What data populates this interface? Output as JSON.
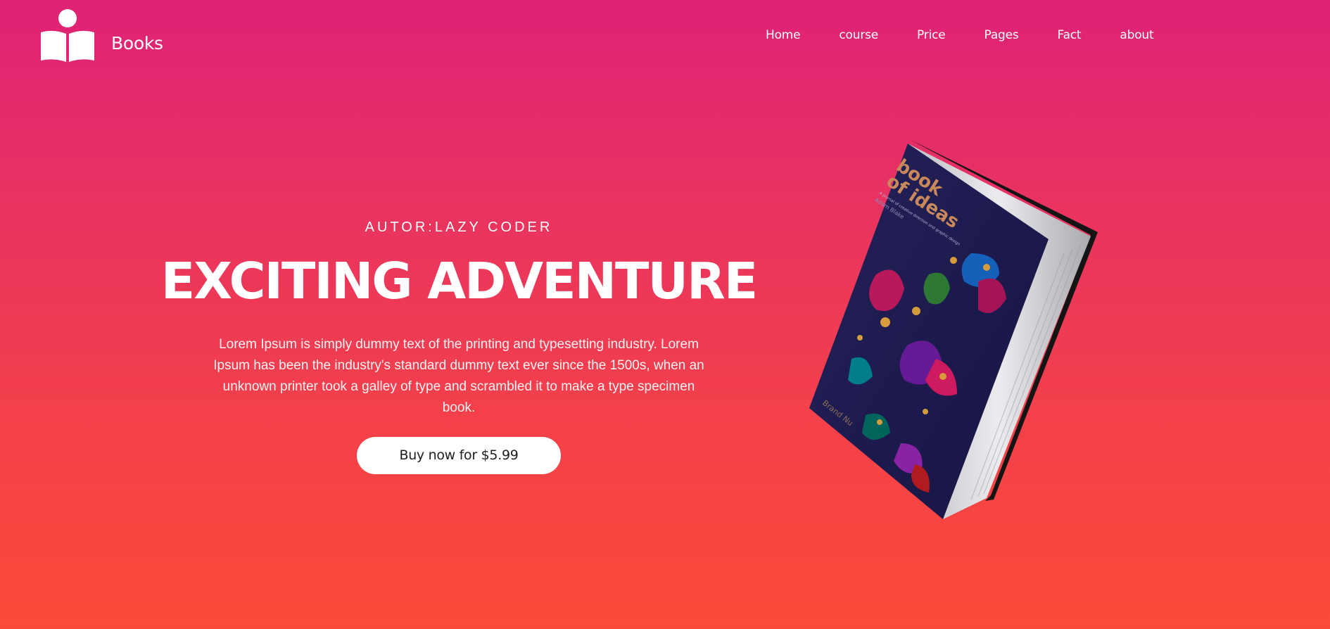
{
  "header": {
    "brand_name": "Books",
    "logo_icon": "open-book-reader-icon",
    "nav": [
      {
        "label": "Home"
      },
      {
        "label": "course"
      },
      {
        "label": "Price"
      },
      {
        "label": "Pages"
      },
      {
        "label": "Fact"
      },
      {
        "label": "about"
      }
    ]
  },
  "hero": {
    "author": "AUTOR:LAZY CODER",
    "title": "EXCITING ADVENTURE",
    "description": "Lorem Ipsum is simply dummy text of the printing and typesetting industry. Lorem Ipsum has been the industry's standard dummy text ever since the 1500s, when an unknown printer took a galley of type and scrambled it to make a type specimen book.",
    "buy_button": "Buy now for $5.99"
  },
  "book": {
    "title_line1": "book",
    "title_line2": "of ideas",
    "subtitle": "A journal of creative direction and graphic design",
    "author_on_cover": "Adam Blake",
    "publisher": "Brand Nu"
  },
  "colors": {
    "gradient_top": "#de2276",
    "gradient_bottom": "#fa4a37",
    "button_bg": "#ffffff",
    "button_text": "#1d1d1f",
    "book_cover": "#1f1d4d",
    "book_title": "#c9885a"
  }
}
